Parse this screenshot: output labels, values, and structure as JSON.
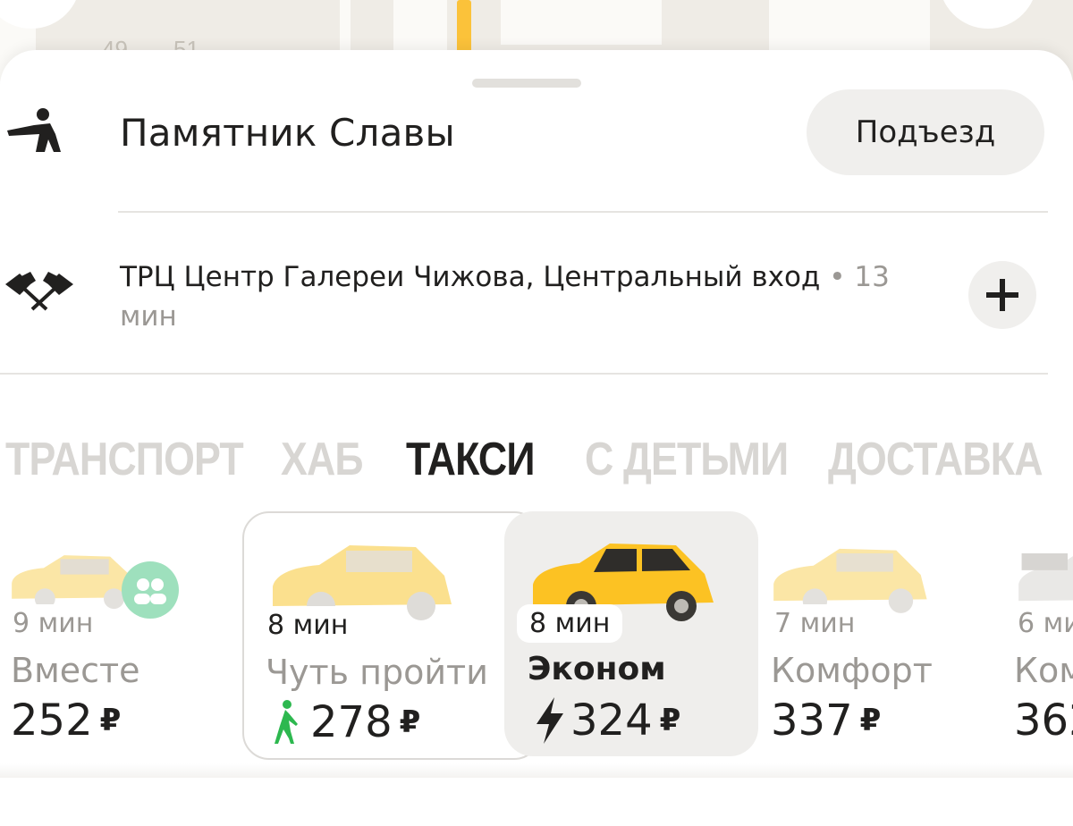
{
  "map": {
    "labels": [
      "49",
      "51"
    ]
  },
  "pickup": {
    "title": "Памятник Славы",
    "entrance_label": "Подъезд"
  },
  "destination": {
    "text": "ТРЦ Центр Галереи Чижова, Центральный вход",
    "eta": "• 13 мин"
  },
  "tabs": [
    {
      "label": "ТРАНСПОРТ",
      "active": false
    },
    {
      "label": "ХАБ",
      "active": false
    },
    {
      "label": "ТАКСИ",
      "active": true
    },
    {
      "label": "С ДЕТЬМИ",
      "active": false
    },
    {
      "label": "ДОСТАВКА",
      "active": false
    }
  ],
  "tariffs": [
    {
      "eta": "9 мин",
      "name": "Вместе",
      "price": "252",
      "currency": "₽"
    },
    {
      "eta": "8 мин",
      "name": "Чуть пройти",
      "price": "278",
      "currency": "₽"
    },
    {
      "eta": "8 мин",
      "name": "Эконом",
      "price": "324",
      "currency": "₽"
    },
    {
      "eta": "7 мин",
      "name": "Комфорт",
      "price": "337",
      "currency": "₽"
    },
    {
      "eta": "6 мин",
      "name": "Комфорт+",
      "price": "362",
      "currency": "₽"
    }
  ],
  "colors": {
    "accent_yellow": "#fbc23a",
    "walk_green": "#2db84f",
    "share_green": "#6ad19a"
  },
  "icons": [
    "pickup-person-icon",
    "finish-flags-icon",
    "plus-icon",
    "walk-icon",
    "lightning-icon",
    "share-people-icon"
  ]
}
